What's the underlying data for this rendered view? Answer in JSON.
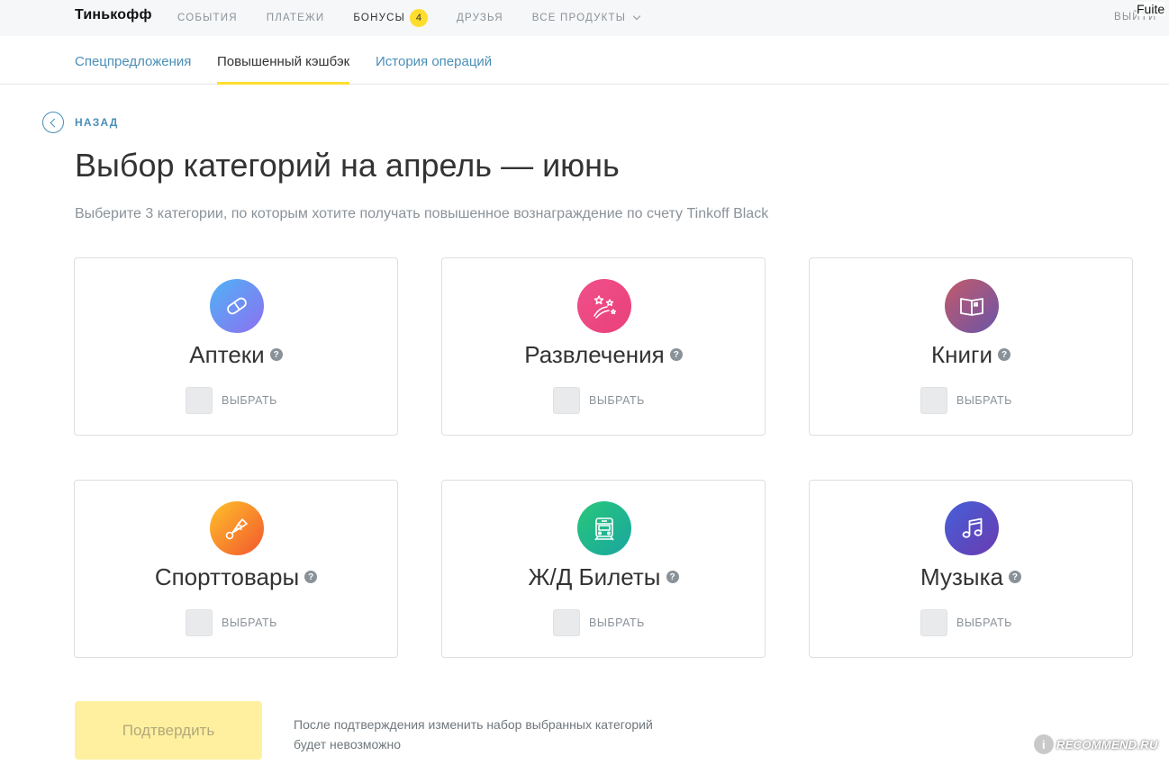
{
  "header": {
    "logo": "Тинькофф",
    "nav": [
      {
        "label": "События"
      },
      {
        "label": "Платежи"
      },
      {
        "label": "Бонусы",
        "badge": "4"
      },
      {
        "label": "Друзья"
      },
      {
        "label": "Все продукты"
      }
    ],
    "logout": "Выйти",
    "overlay_text": "Fuite"
  },
  "subtabs": [
    {
      "label": "Спецпредложения"
    },
    {
      "label": "Повышенный кэшбэк",
      "active": true
    },
    {
      "label": "История операций"
    }
  ],
  "back_label": "Назад",
  "title": "Выбор категорий на апрель — июнь",
  "subtitle": "Выберите 3 категории, по которым хотите получать повышенное вознаграждение по счету Tinkoff Black",
  "help_glyph": "?",
  "categories": [
    {
      "name": "Аптеки",
      "choose": "Выбрать",
      "icon": "pill-icon",
      "colors": [
        "#4fb3f6",
        "#8d6ff0"
      ]
    },
    {
      "name": "Развлечения",
      "choose": "Выбрать",
      "icon": "fireworks-icon",
      "colors": [
        "#f0508a",
        "#e9407a"
      ]
    },
    {
      "name": "Книги",
      "choose": "Выбрать",
      "icon": "book-icon",
      "colors": [
        "#c45a6a",
        "#6a55a8"
      ]
    },
    {
      "name": "Спорттовары",
      "choose": "Выбрать",
      "icon": "shuttlecock-icon",
      "colors": [
        "#ffc12a",
        "#f2562e"
      ]
    },
    {
      "name": "Ж/Д Билеты",
      "choose": "Выбрать",
      "icon": "train-icon",
      "colors": [
        "#28c77a",
        "#1aa6a0"
      ]
    },
    {
      "name": "Музыка",
      "choose": "Выбрать",
      "icon": "music-note-icon",
      "colors": [
        "#4560d8",
        "#6a3bb0"
      ]
    }
  ],
  "confirm_label": "Подтвердить",
  "note": "После подтверждения изменить набор выбранных категорий будет невозможно",
  "watermark": "RECOMMEND.RU",
  "watermark_glyph": "i",
  "accent_colors": {
    "link": "#4a8fb8",
    "yellow": "#ffdd2d",
    "confirm_disabled": "#fff0a0"
  }
}
